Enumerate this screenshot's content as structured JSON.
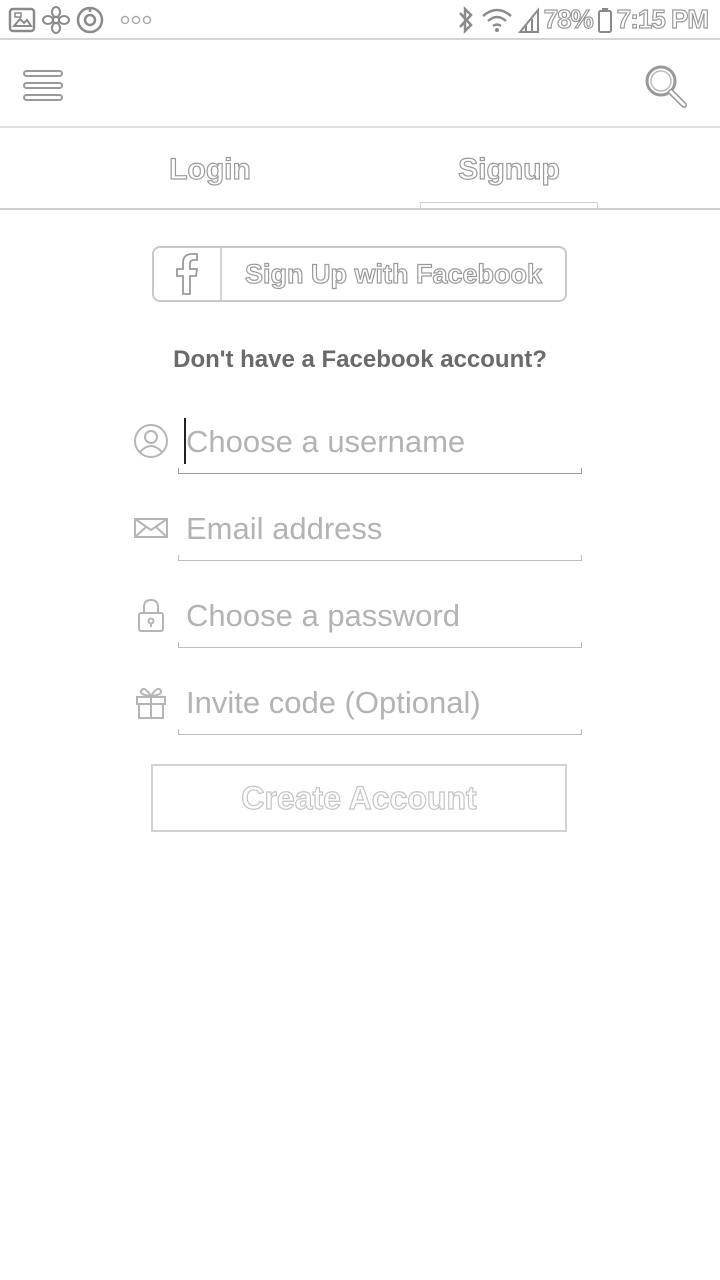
{
  "status_bar": {
    "battery": "78%",
    "time": "7:15 PM",
    "left_icons": [
      "gallery-icon",
      "pinwheel-icon",
      "target-icon",
      "more-dots-icon"
    ],
    "right_icons": [
      "bluetooth-icon",
      "wifi-icon",
      "signal-icon",
      "battery-icon"
    ]
  },
  "app_bar": {
    "menu_icon": "hamburger-menu-icon",
    "search_icon": "search-icon"
  },
  "tabs": [
    {
      "label": "Login",
      "selected": false
    },
    {
      "label": "Signup",
      "selected": true
    }
  ],
  "facebook": {
    "icon": "facebook-icon",
    "label": "Sign Up with Facebook"
  },
  "prompt": "Don't have a Facebook account?",
  "form": {
    "username": {
      "icon": "user-icon",
      "placeholder": "Choose a username",
      "value": ""
    },
    "email": {
      "icon": "envelope-icon",
      "placeholder": "Email address",
      "value": ""
    },
    "password": {
      "icon": "lock-icon",
      "placeholder": "Choose a password",
      "value": ""
    },
    "invite": {
      "icon": "gift-icon",
      "placeholder": "Invite code (Optional)",
      "value": ""
    }
  },
  "create_button": {
    "label": "Create Account",
    "enabled": false
  },
  "colors": {
    "outline": "#9a9a9a",
    "divider": "#d6d6d6",
    "placeholder": "#b3b3b3"
  }
}
